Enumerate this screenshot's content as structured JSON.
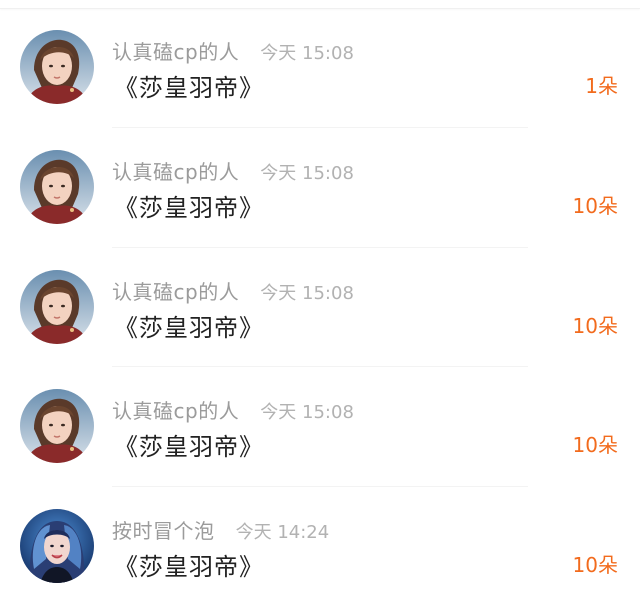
{
  "colors": {
    "accent": "#f26b1d",
    "username": "#9b9b9b",
    "time": "#b2b2b2",
    "content": "#222222"
  },
  "comments": [
    {
      "avatar": "avatar-icon",
      "username": "认真磕cp的人",
      "time": "今天 15:08",
      "content": "《莎皇羽帝》",
      "gift": "1朵"
    },
    {
      "avatar": "avatar-icon",
      "username": "认真磕cp的人",
      "time": "今天 15:08",
      "content": "《莎皇羽帝》",
      "gift": "10朵"
    },
    {
      "avatar": "avatar-icon",
      "username": "认真磕cp的人",
      "time": "今天 15:08",
      "content": "《莎皇羽帝》",
      "gift": "10朵"
    },
    {
      "avatar": "avatar-icon",
      "username": "认真磕cp的人",
      "time": "今天 15:08",
      "content": "《莎皇羽帝》",
      "gift": "10朵"
    },
    {
      "avatar": "avatar-icon",
      "username": "按时冒个泡",
      "time": "今天 14:24",
      "content": "《莎皇羽帝》",
      "gift": "10朵"
    }
  ]
}
